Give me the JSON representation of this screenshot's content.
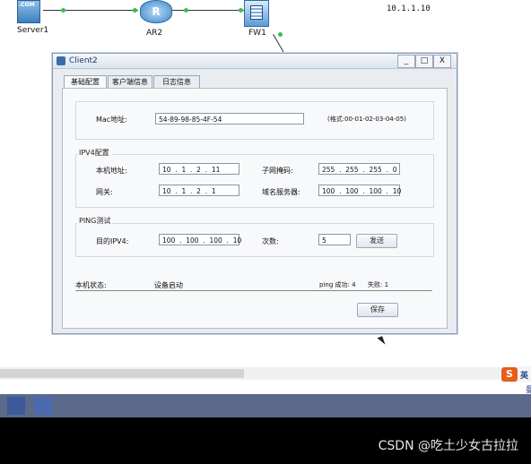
{
  "topology": {
    "nodes": [
      {
        "label": "Server1",
        "icon_text": ".COM"
      },
      {
        "label": "AR2",
        "icon_text": "R"
      },
      {
        "label": "FW1",
        "icon_text": ""
      }
    ],
    "ip_label": "10.1.1.10"
  },
  "window": {
    "title": "Client2",
    "controls": {
      "minimize": "_",
      "maximize": "□",
      "close": "X"
    },
    "tabs": [
      "基础配置",
      "客户端信息",
      "日志信息"
    ],
    "mac": {
      "label": "Mac地址:",
      "value": "54-89-98-85-4F-54",
      "hint": "(格式:00-01-02-03-04-05)"
    },
    "ipv4": {
      "group_title": "IPV4配置",
      "host_ip_label": "本机地址:",
      "host_ip": "10  .  1  .  2  .  11",
      "mask_label": "子网掩码:",
      "mask": "255  .  255  .  255  .  0",
      "gateway_label": "网关:",
      "gateway": "10  .  1  .  2  .  1",
      "dns_label": "域名服务器:",
      "dns": "100  .  100  .  100  .  10"
    },
    "ping": {
      "group_title": "PING测试",
      "dest_label": "目的IPV4:",
      "dest": "100  .  100  .  100  .  10",
      "count_label": "次数:",
      "count": "5",
      "send_button": "发送"
    },
    "status": {
      "label": "本机状态:",
      "value": "设备启动",
      "ping_success": "ping 成功: 4",
      "fail": "失败: 1"
    },
    "save_button": "保存"
  },
  "ime": {
    "logo": "S",
    "text": "英"
  },
  "side_char": "曼",
  "watermark": "CSDN @吃土少女古拉拉"
}
